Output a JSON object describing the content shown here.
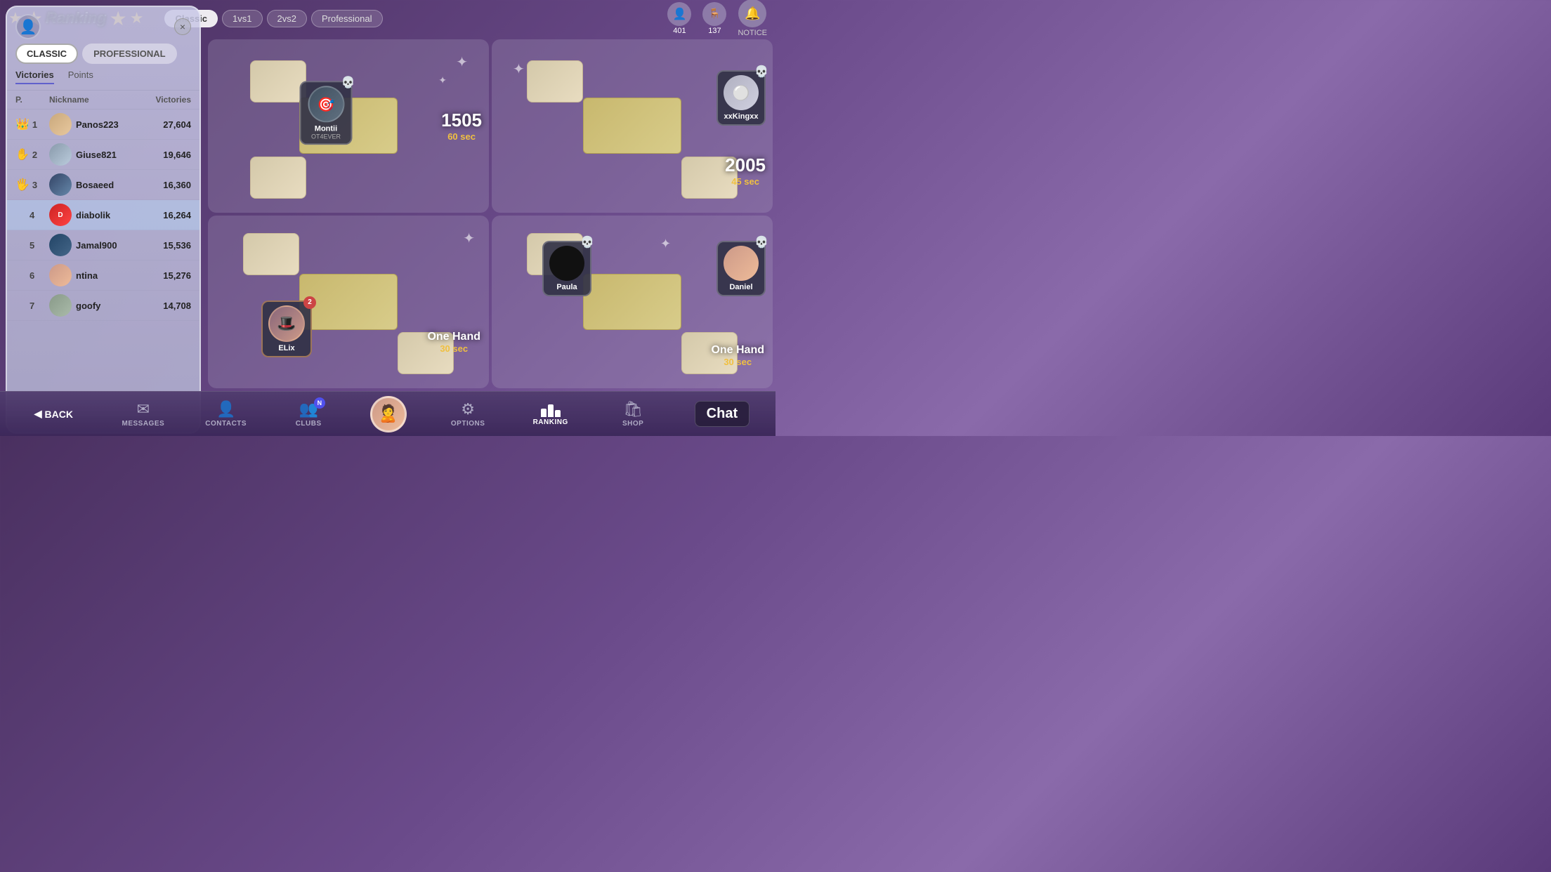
{
  "app": {
    "title": "Ranking"
  },
  "top_bar": {
    "mode_tabs": [
      {
        "id": "classic",
        "label": "Classic",
        "active": true
      },
      {
        "id": "1vs1",
        "label": "1vs1",
        "active": false
      },
      {
        "id": "2vs2",
        "label": "2vs2",
        "active": false
      },
      {
        "id": "professional",
        "label": "Professional",
        "active": false
      }
    ],
    "friends_count": "401",
    "tables_count": "137",
    "notice_label": "NOTICE"
  },
  "panel": {
    "close_label": "×",
    "tab_classic": "CLASSIC",
    "tab_professional": "PROFESSIONAL",
    "sort_victories": "Victories",
    "sort_points": "Points",
    "col_position": "P.",
    "col_nickname": "Nickname",
    "col_victories": "Victories",
    "players": [
      {
        "rank": 1,
        "name": "Panos223",
        "victories": "27,604",
        "highlight": false
      },
      {
        "rank": 2,
        "name": "Giuse821",
        "victories": "19,646",
        "highlight": false
      },
      {
        "rank": 3,
        "name": "Bosaeed",
        "victories": "16,360",
        "highlight": false
      },
      {
        "rank": 4,
        "name": "diabolik",
        "victories": "16,264",
        "highlight": true
      },
      {
        "rank": 5,
        "name": "Jamal900",
        "victories": "15,536",
        "highlight": false
      },
      {
        "rank": 6,
        "name": "ntina",
        "victories": "15,276",
        "highlight": false
      },
      {
        "rank": 7,
        "name": "goofy",
        "victories": "14,708",
        "highlight": false
      }
    ]
  },
  "game_tables": [
    {
      "id": "table1",
      "player_name": "Montii",
      "player_sub": "OT4EVER",
      "score": "1505",
      "time": "60 sec",
      "opponent": "xxKingxx"
    },
    {
      "id": "table2",
      "player_name": "ELix",
      "score": "",
      "time": "30 sec",
      "type": "One Hand"
    },
    {
      "id": "table3",
      "player_name": "Paula",
      "score": "2005",
      "time": "45 sec",
      "opponent": "xxKingxx"
    },
    {
      "id": "table4",
      "player_name": "Daniel",
      "score": "",
      "time": "30 sec",
      "type": "One Hand"
    }
  ],
  "scores": {
    "table1_score": "1505",
    "table1_time": "60 sec",
    "table2_score": "2005",
    "table2_time": "45 sec",
    "table3_type": "One Hand",
    "table3_time": "30 sec",
    "table4_type": "One Hand",
    "table4_time": "30 sec"
  },
  "bottom_nav": {
    "back_label": "BACK",
    "items": [
      {
        "id": "messages",
        "label": "MESSAGES",
        "icon": "✉",
        "active": false,
        "badge": null
      },
      {
        "id": "contacts",
        "label": "CONTACTS",
        "icon": "👤",
        "active": false,
        "badge": null
      },
      {
        "id": "clubs",
        "label": "CLUBS",
        "icon": "👥",
        "active": false,
        "badge": "N"
      },
      {
        "id": "options",
        "label": "OPTIONS",
        "icon": "⚙",
        "active": false,
        "badge": null
      },
      {
        "id": "ranking",
        "label": "RANKING",
        "icon": "🏆",
        "active": true,
        "badge": null
      },
      {
        "id": "shop",
        "label": "SHOP",
        "icon": "🛍",
        "active": false,
        "badge": null
      }
    ],
    "chat_label": "Chat"
  }
}
